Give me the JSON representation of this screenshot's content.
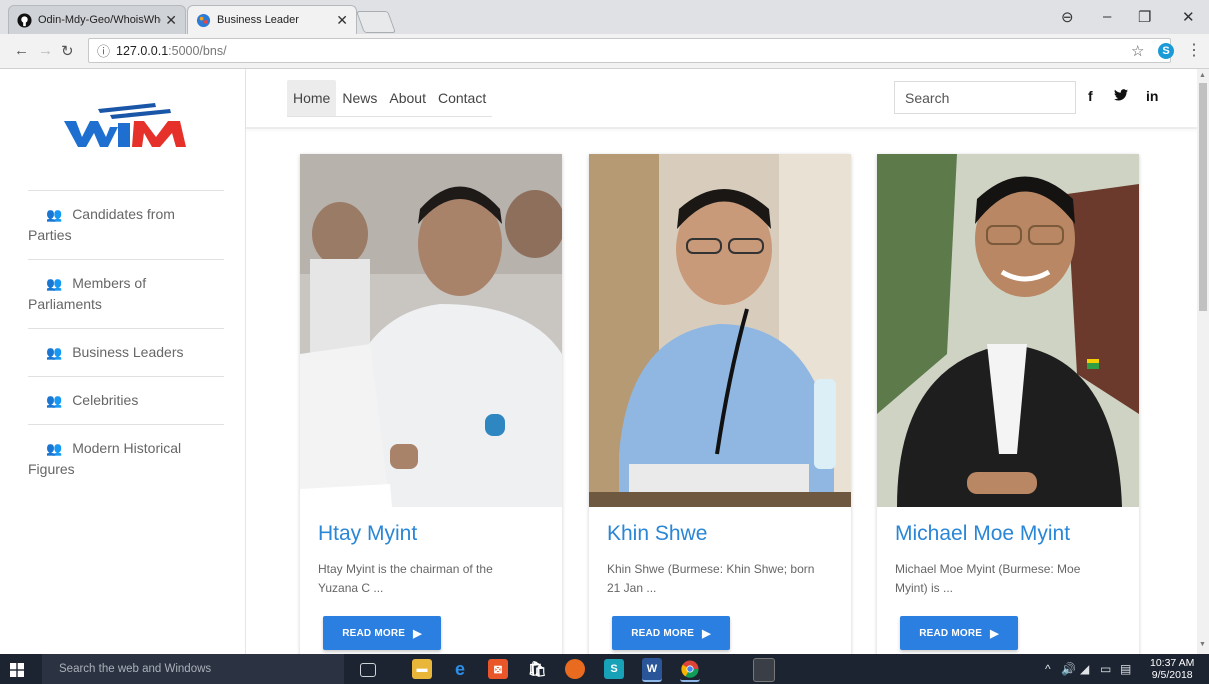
{
  "browser": {
    "tabs": [
      {
        "title": "Odin-Mdy-Geo/WhoisWhoin",
        "active": false
      },
      {
        "title": "Business Leader",
        "active": true
      }
    ],
    "url_host": "127.0.0.1",
    "url_path": ":5000/bns/",
    "window_controls": {
      "profile": "⊖",
      "minimize": "–",
      "restore": "❐",
      "close": "✕"
    }
  },
  "sidebar": {
    "items": [
      {
        "first": "Candidates from",
        "rest": "Parties"
      },
      {
        "first": "Members of",
        "rest": "Parliaments"
      },
      {
        "first": "Business Leaders",
        "rest": ""
      },
      {
        "first": "Celebrities",
        "rest": ""
      },
      {
        "first": "Modern Historical",
        "rest": "Figures"
      }
    ]
  },
  "nav": {
    "links": [
      "Home",
      "News",
      "About",
      "Contact"
    ],
    "active": "Home",
    "search_placeholder": "Search",
    "social": {
      "facebook": "f",
      "twitter": "🐦",
      "linkedin": "in"
    }
  },
  "cards": [
    {
      "name": "Htay Myint",
      "desc_line1": "Htay Myint is the chairman of the",
      "desc_line2": "Yuzana C ...",
      "button": "READ MORE"
    },
    {
      "name": "Khin Shwe",
      "desc_line1": "Khin Shwe (Burmese: Khin Shwe; born",
      "desc_line2": "21 Jan ...",
      "button": "READ MORE"
    },
    {
      "name": "Michael Moe Myint",
      "desc_line1": "Michael Moe Myint (Burmese: Moe",
      "desc_line2": "Myint) is ...",
      "button": "READ MORE"
    }
  ],
  "taskbar": {
    "search_text": "Search the web and Windows",
    "time": "10:37 AM",
    "date": "9/5/2018"
  },
  "colors": {
    "accent_blue": "#2b7fe0",
    "name_blue": "#2a86d6",
    "taskbar": "#1c2431"
  }
}
